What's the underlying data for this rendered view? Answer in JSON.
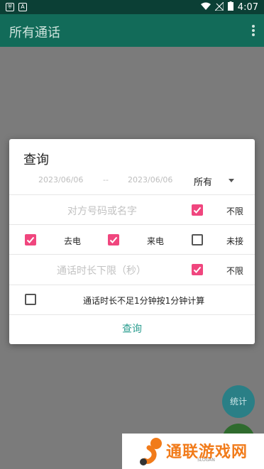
{
  "status_bar": {
    "time": "4:07",
    "icons": [
      "shield-icon",
      "a-icon",
      "wifi-icon",
      "signal-off-icon",
      "battery-icon"
    ]
  },
  "app_bar": {
    "title": "所有通话",
    "menu_icon": "more-vert-icon"
  },
  "dialog": {
    "title": "查询",
    "date_start": "2023/06/06",
    "date_separator": "--",
    "date_end": "2023/06/06",
    "type_select": {
      "value": "所有"
    },
    "name_placeholder": "对方号码或名字",
    "unlimited_label": "不限",
    "name_unlimited_checked": true,
    "call_types": [
      {
        "label": "去电",
        "checked": true
      },
      {
        "label": "来电",
        "checked": true
      },
      {
        "label": "未接",
        "checked": false
      }
    ],
    "duration_placeholder": "通话时长下限（秒）",
    "duration_unlimited_checked": true,
    "round_minute_label": "通话时长不足1分钟按1分钟计算",
    "round_minute_checked": false,
    "query_button": "查询"
  },
  "fab": {
    "stats_label": "统计"
  },
  "watermark": {
    "text": "通联游戏网",
    "slogan": "SLOGAN"
  },
  "colors": {
    "accent": "#f0467e",
    "primary": "#126b59",
    "button_text": "#2a9d8f"
  }
}
